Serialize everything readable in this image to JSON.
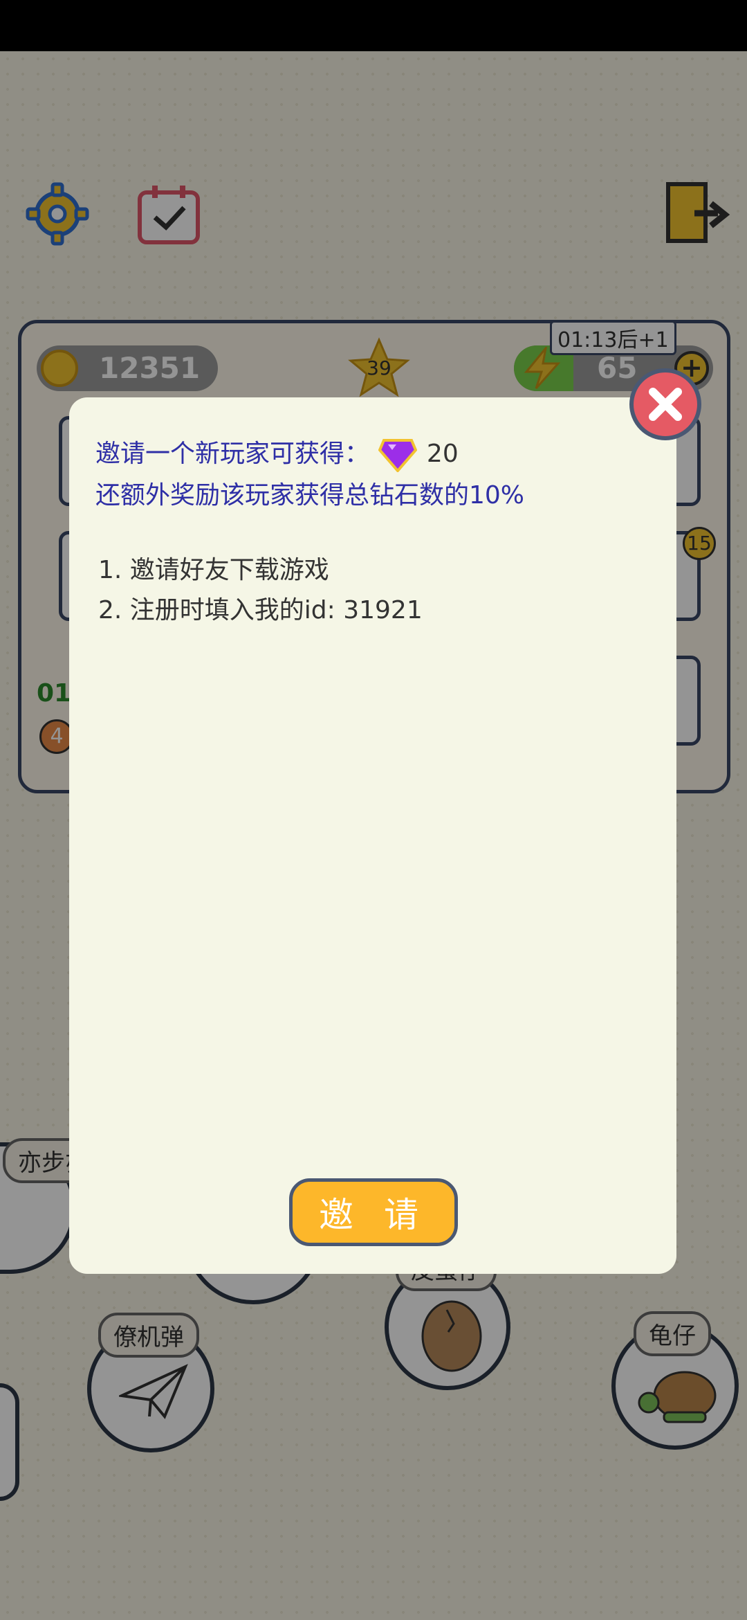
{
  "hud": {
    "coins": "12351",
    "stars": "39",
    "energy": "65",
    "energy_timer": "01:13后+1",
    "badge_count": "15",
    "timer_partial": "01",
    "level_partial": "4"
  },
  "characters": [
    {
      "label": "亦步亦"
    },
    {
      "label": "皮蛋仔"
    },
    {
      "label": "僚机弹"
    },
    {
      "label": "龟仔"
    }
  ],
  "dialog": {
    "reward_line": "邀请一个新玩家可获得：",
    "reward_amount": "20",
    "bonus_line": "还额外奖励该玩家获得总钻石数的10%",
    "step1": "1. 邀请好友下载游戏",
    "step2": "2. 注册时填入我的id: 31921",
    "invite_button": "邀 请"
  },
  "colors": {
    "dialog_bg": "#f5f6e6",
    "text_blue": "#2e2fa6",
    "button_orange": "#fdb72a",
    "close_red": "#e55a64"
  }
}
